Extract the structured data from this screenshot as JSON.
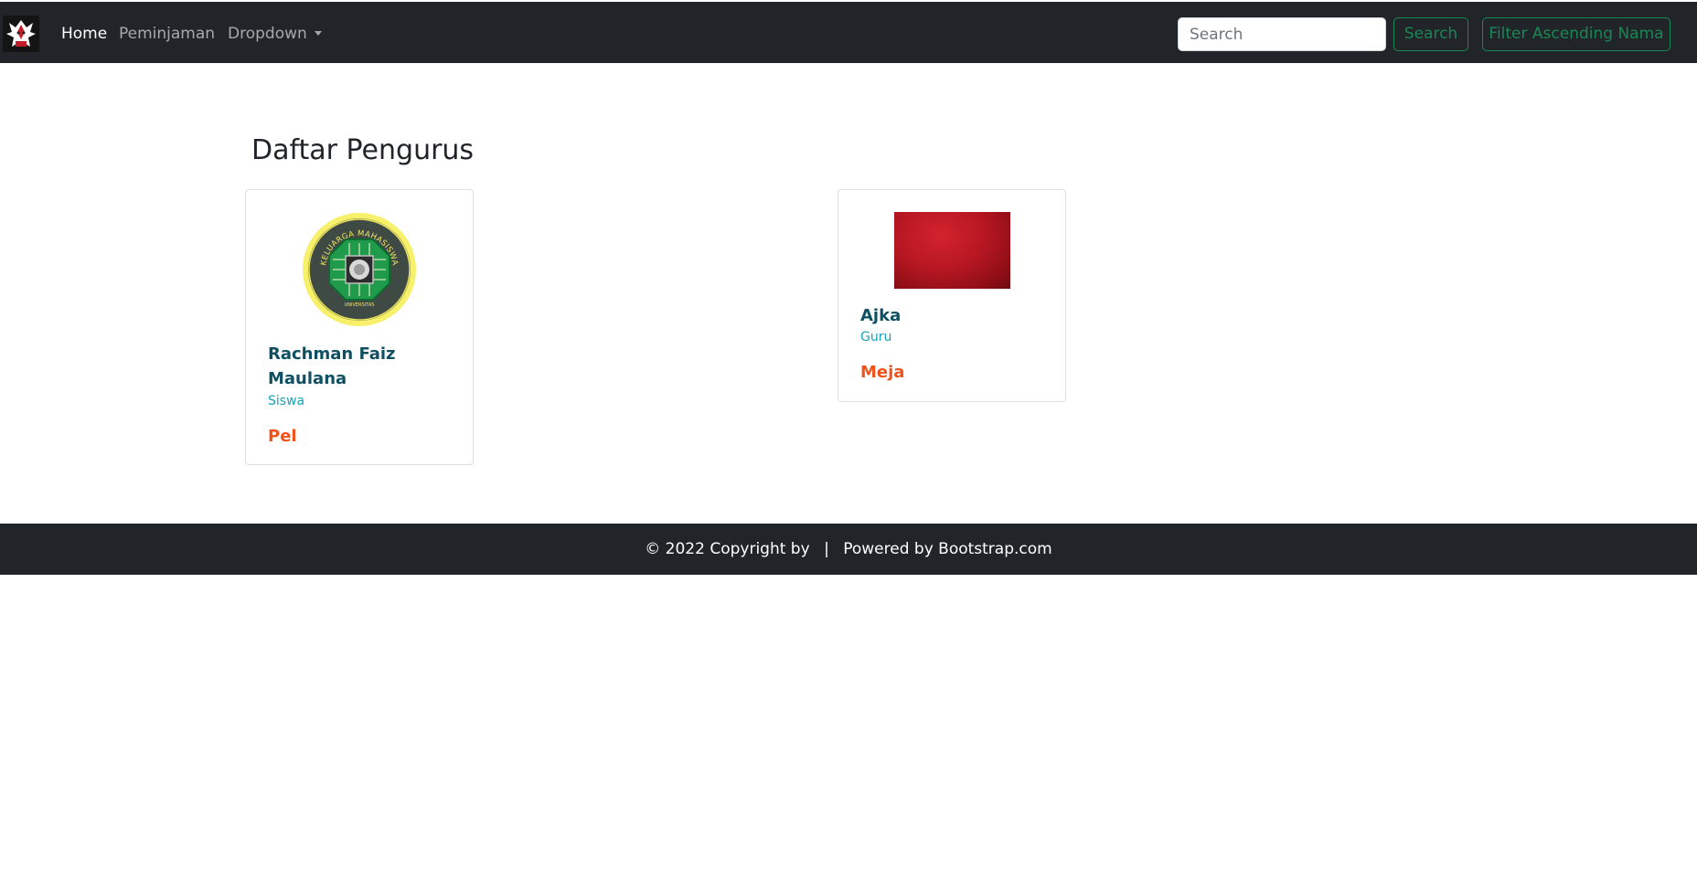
{
  "navbar": {
    "brand_icon": "gundam-logo-icon",
    "links": [
      {
        "label": "Home",
        "active": true
      },
      {
        "label": "Peminjaman",
        "active": false
      },
      {
        "label": "Dropdown",
        "active": false
      }
    ],
    "search": {
      "placeholder": "Search",
      "value": ""
    },
    "search_button_label": "Search",
    "filter_button_label": "Filter Ascending Nama"
  },
  "main": {
    "title": "Daftar Pengurus",
    "cards": [
      {
        "name": "Rachman Faiz Maulana",
        "role": "Siswa",
        "item": "Pel",
        "image": "kmk-emblem",
        "image_text": "KELUARGA MAHASISWA KOMPUTER",
        "image_subtext": "UNIVERSITAS"
      },
      {
        "name": "Ajka",
        "role": "Guru",
        "item": "Meja",
        "image": "red-texture-image"
      }
    ]
  },
  "footer": {
    "copyright": "© 2022 Copyright by",
    "separator": "|",
    "powered": "Powered by Bootstrap.com"
  },
  "colors": {
    "navbar_bg": "#212529",
    "accent_green": "#198754",
    "name_color": "#0e5062",
    "role_color": "#17a2b8",
    "item_color": "#f0531c"
  }
}
